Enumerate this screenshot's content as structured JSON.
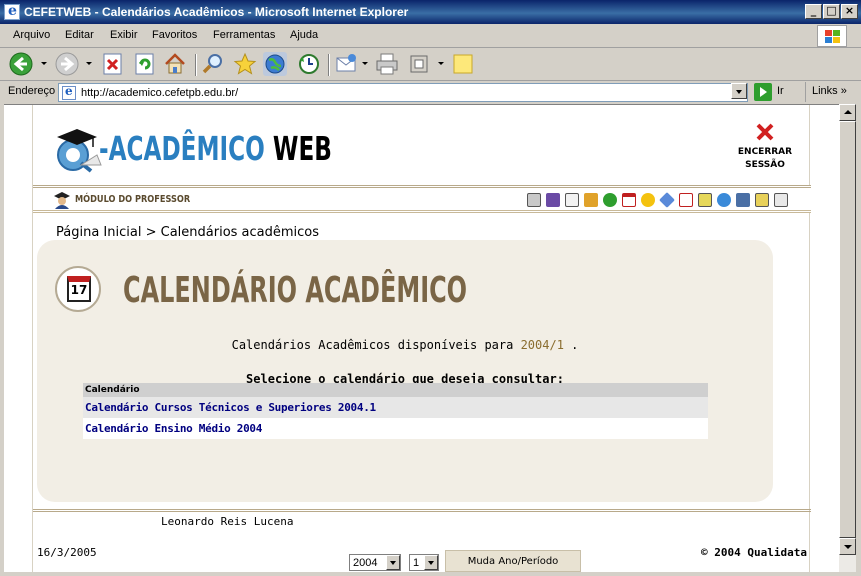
{
  "window": {
    "title": "CEFETWEB - Calendários Acadêmicos - Microsoft Internet Explorer"
  },
  "menu": [
    "Arquivo",
    "Editar",
    "Exibir",
    "Favoritos",
    "Ferramentas",
    "Ajuda"
  ],
  "address": {
    "label": "Endereço",
    "url": "http://academico.cefetpb.edu.br/",
    "go_label": "Ir",
    "links_label": "Links"
  },
  "header": {
    "logo_part1": "-ACADÊMICO",
    "logo_part2": "WEB",
    "logout_label": "ENCERRAR\nSESSÃO",
    "module_label": "MÓDULO DO PROFESSOR"
  },
  "breadcrumb": {
    "home": "Página Inicial",
    "separator": " > ",
    "current": "Calendários acadêmicos"
  },
  "main": {
    "calendar_day": "17",
    "title": "CALENDÁRIO ACADÊMICO",
    "intro_text": "Calendários Acadêmicos disponíveis para ",
    "period": "2004/1",
    "intro_end": " .",
    "select_message": "Selecione o calendário que deseja consultar:"
  },
  "table": {
    "header": "Calendário",
    "rows": [
      "Calendário Cursos Técnicos e Superiores 2004.1",
      "Calendário Ensino Médio 2004"
    ]
  },
  "footer": {
    "user": "Leonardo Reis Lucena",
    "date": "16/3/2005",
    "copyright": "© 2004 Qualidata",
    "year_value": "2004",
    "period_value": "1",
    "change_button": "Muda Ano/Período"
  }
}
